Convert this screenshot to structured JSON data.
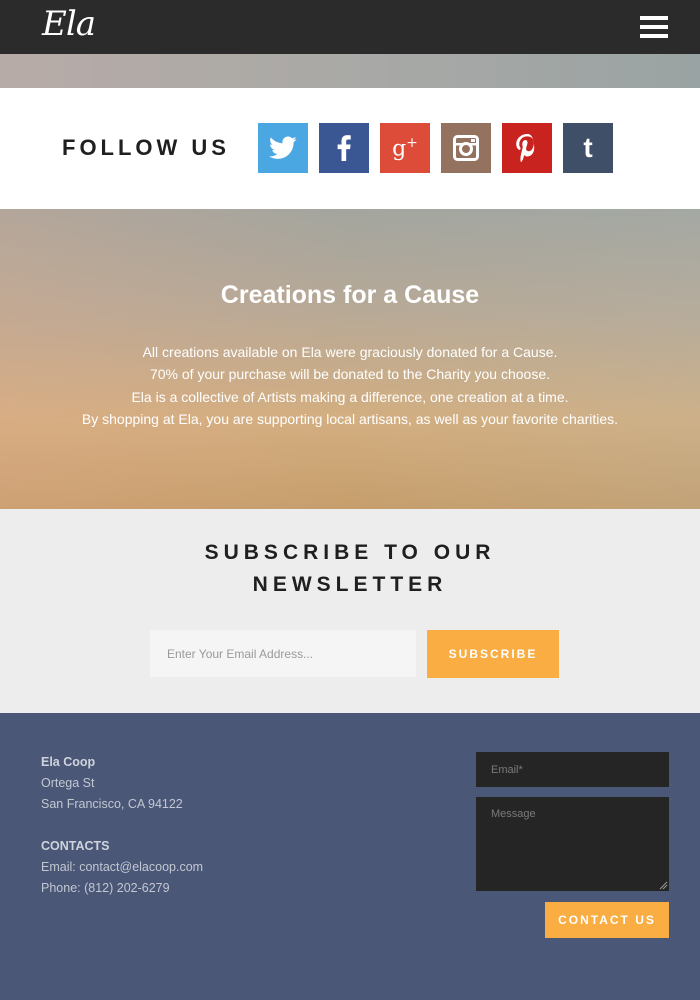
{
  "header": {
    "logo_text": "Ela",
    "menu_icon": "hamburger-menu-icon"
  },
  "follow": {
    "title": "FOLLOW US",
    "networks": [
      {
        "name": "twitter",
        "icon": "twitter-icon",
        "color": "#4ba7e1"
      },
      {
        "name": "facebook",
        "icon": "facebook-icon",
        "color": "#3a5794"
      },
      {
        "name": "google-plus",
        "icon": "google-plus-icon",
        "color": "#dd4b39"
      },
      {
        "name": "instagram",
        "icon": "instagram-icon",
        "color": "#93735f"
      },
      {
        "name": "pinterest",
        "icon": "pinterest-icon",
        "color": "#c8231e"
      },
      {
        "name": "tumblr",
        "icon": "tumblr-icon",
        "color": "#3f4f67"
      }
    ]
  },
  "hero": {
    "title": "Creations for a Cause",
    "lines": [
      "All creations available on Ela were graciously donated for a Cause.",
      "70% of your purchase will be donated to the Charity you choose.",
      "Ela is a collective of Artists making a difference, one creation at a time.",
      "By shopping at Ela, you are supporting local artisans, as well as your favorite charities."
    ]
  },
  "newsletter": {
    "title_line1": "SUBSCRIBE TO OUR",
    "title_line2": "NEWSLETTER",
    "email_placeholder": "Enter Your Email Address...",
    "button_label": "SUBSCRIBE",
    "accent_color": "#f9ad42"
  },
  "footer": {
    "company_name": "Ela Coop",
    "address_line1": "Ortega St",
    "address_line2": "San Francisco, CA 94122",
    "contacts_heading": "CONTACTS",
    "email_line": "Email: contact@elacoop.com",
    "phone_line": "Phone: (812) 202-6279",
    "form": {
      "email_placeholder": "Email*",
      "message_placeholder": "Message",
      "button_label": "CONTACT US"
    },
    "background_color": "#4a5777"
  }
}
